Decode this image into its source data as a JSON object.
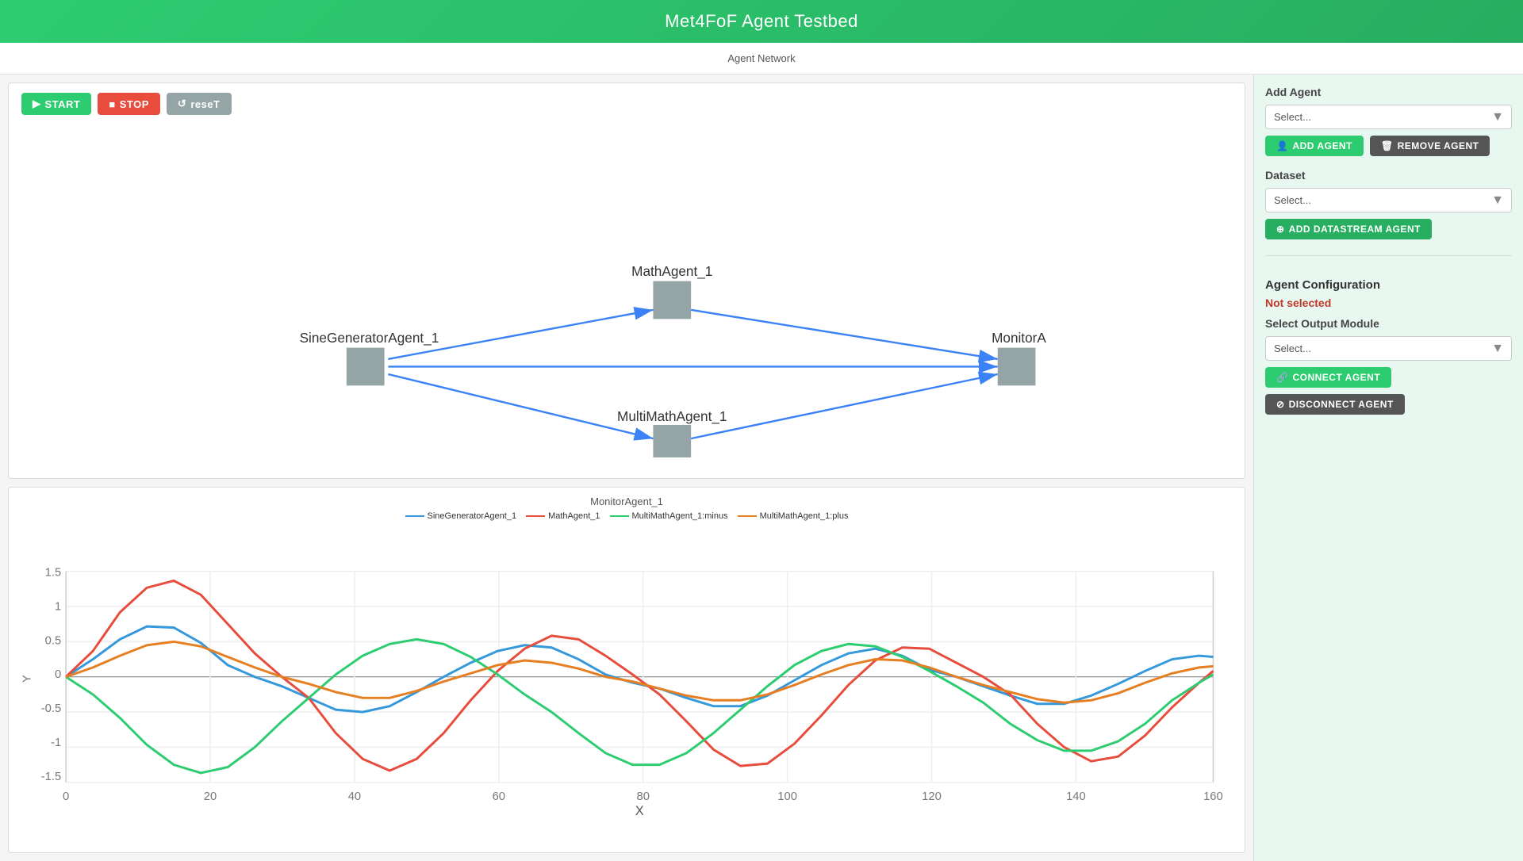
{
  "app": {
    "title": "Met4FoF Agent Testbed"
  },
  "subheader": {
    "label": "Agent Network"
  },
  "toolbar": {
    "start_label": "START",
    "stop_label": "STOP",
    "reset_label": "reseT"
  },
  "agents": {
    "sine_generator": "SineGeneratorAgent_1",
    "math_agent": "MathAgent_1",
    "multi_math_agent": "MultiMathAgent_1",
    "monitor_agent": "MonitorA"
  },
  "sidebar": {
    "add_agent_section_title": "Add Agent",
    "add_agent_select_placeholder": "Select...",
    "add_agent_label": "ADD AGENT",
    "remove_agent_label": "REMOVE AGENT",
    "dataset_section_title": "Dataset",
    "dataset_select_placeholder": "Select...",
    "add_datastream_label": "ADD DATASTREAM AGENT",
    "agent_config_title": "Agent Configuration",
    "not_selected_label": "Not selected",
    "select_output_label": "Select Output Module",
    "output_select_placeholder": "Select...",
    "connect_agent_label": "CONNECT AGENT",
    "disconnect_agent_label": "DISCONNECT AGENT"
  },
  "chart": {
    "title": "MonitorAgent_1",
    "x_label": "X",
    "legend": [
      {
        "name": "SineGeneratorAgent_1",
        "color": "#3498db"
      },
      {
        "name": "MathAgent_1",
        "color": "#e74c3c"
      },
      {
        "name": "MultiMathAgent_1:minus",
        "color": "#2ecc71"
      },
      {
        "name": "MultiMathAgent_1:plus",
        "color": "#e67e22"
      }
    ]
  }
}
